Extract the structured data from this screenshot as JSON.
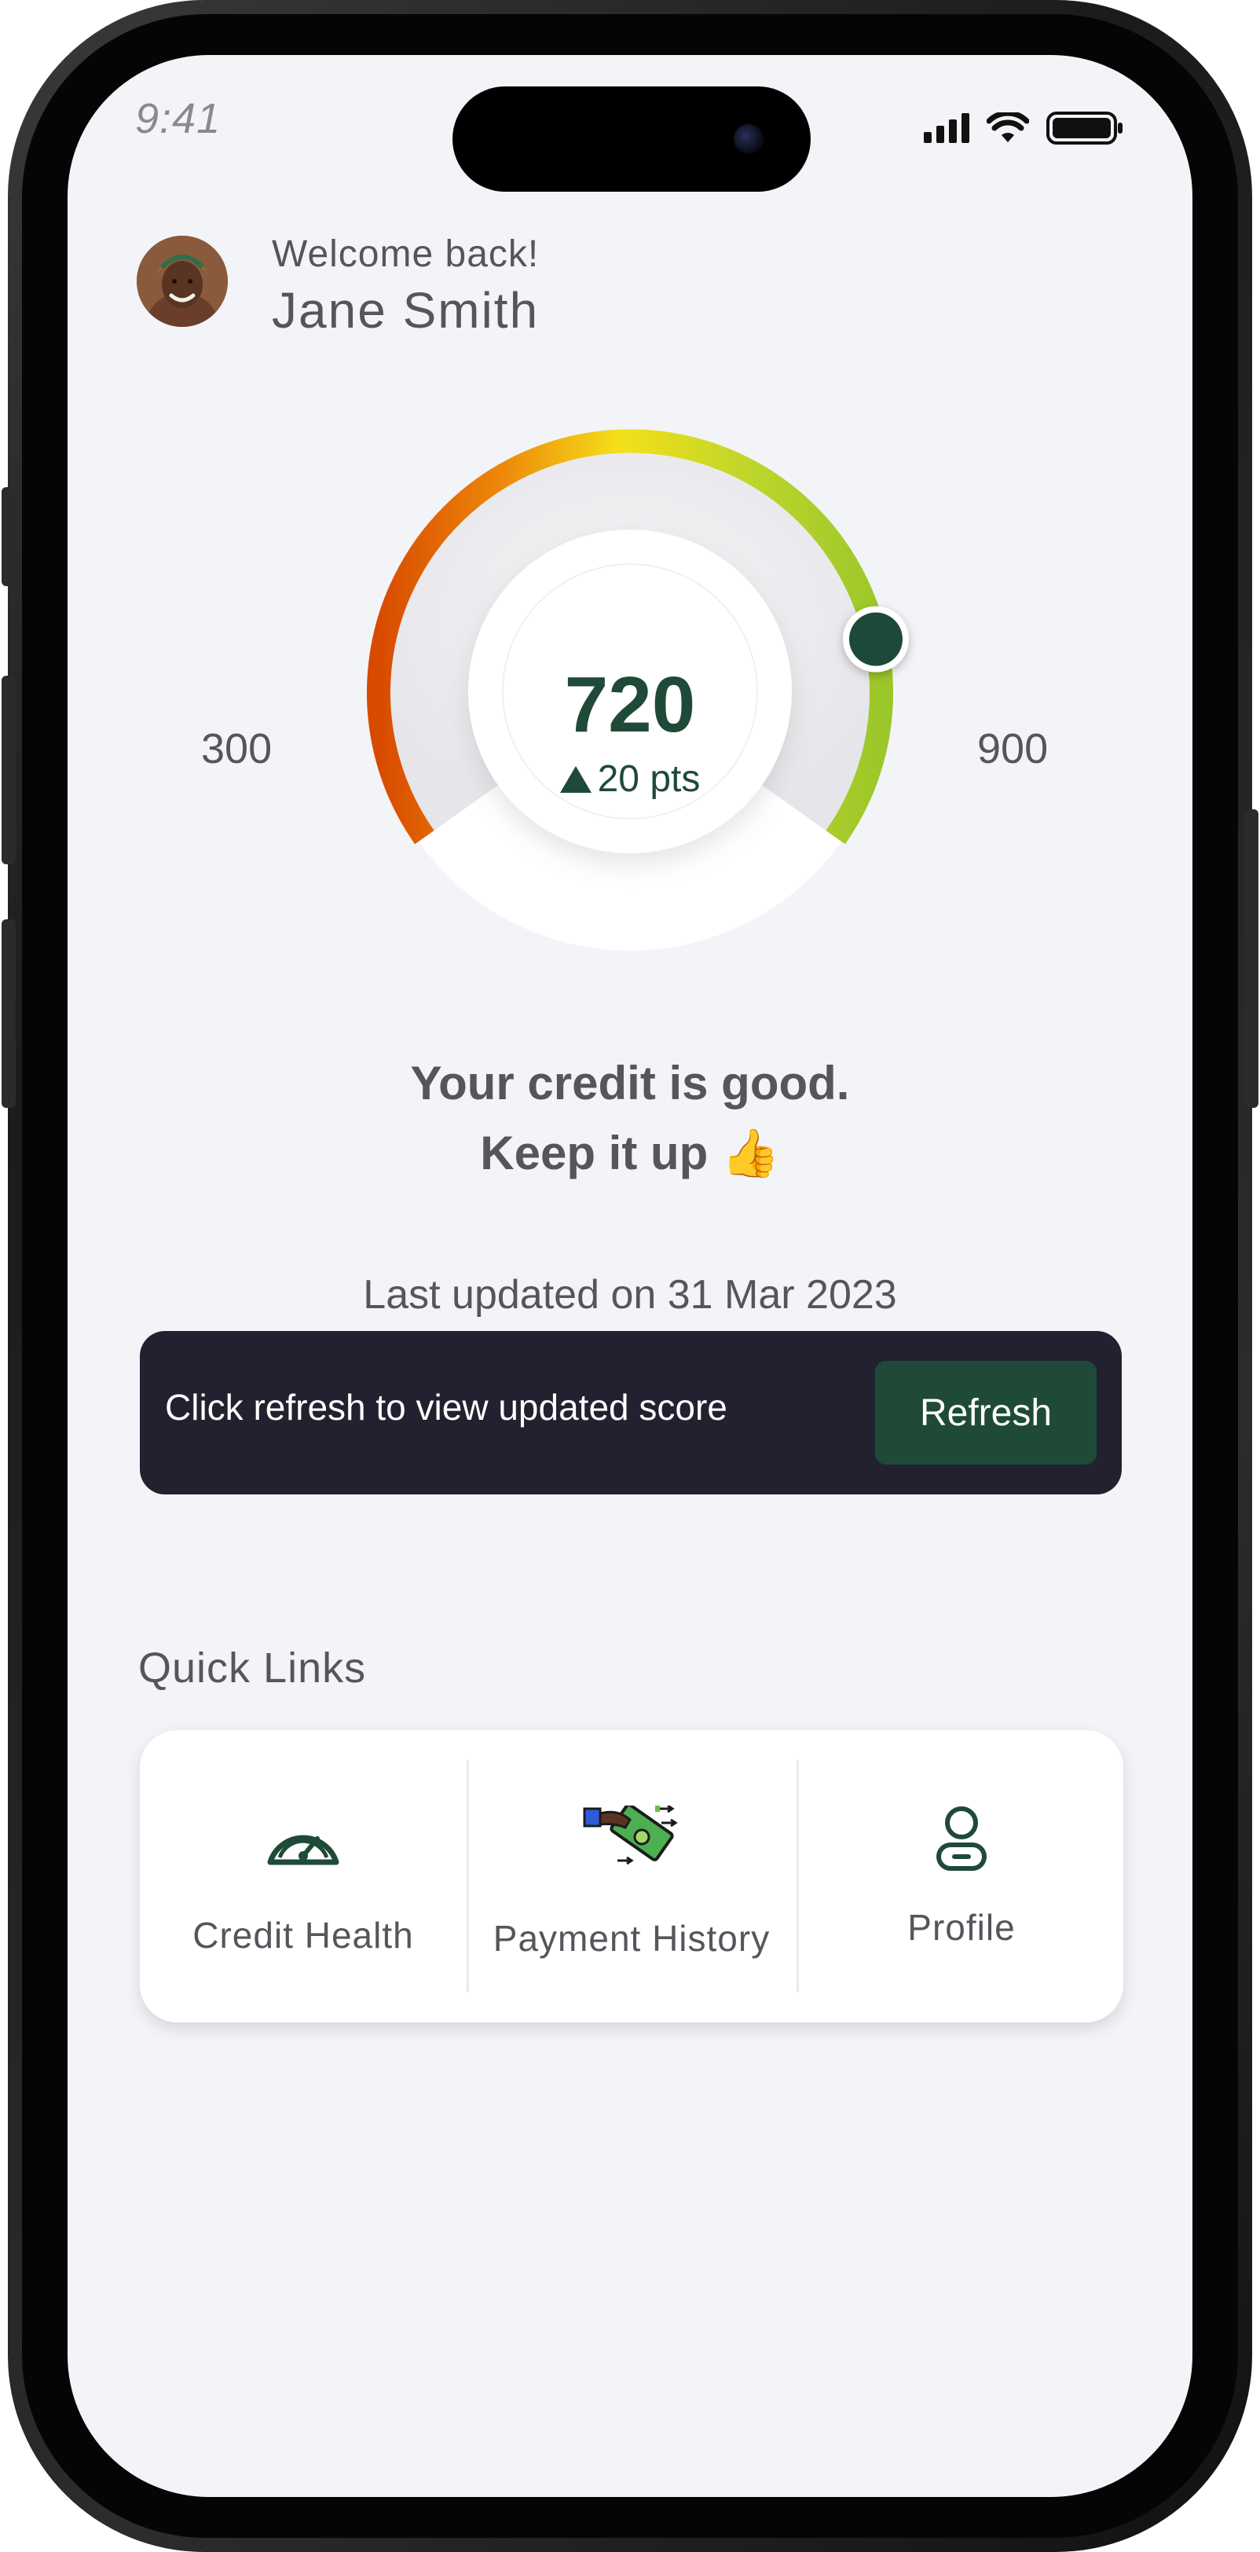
{
  "status_bar": {
    "time": "9:41"
  },
  "header": {
    "greeting": "Welcome back!",
    "user_name": "Jane Smith"
  },
  "credit_score": {
    "score": "720",
    "change": "20 pts",
    "min_label": "300",
    "max_label": "900",
    "score_value": 720,
    "range": [
      300,
      900
    ],
    "marker_color": "#1f4a38"
  },
  "status": {
    "line1": "Your credit is good.",
    "line2": "Keep it up 👍",
    "last_updated": "Last updated on 31 Mar 2023"
  },
  "refresh_banner": {
    "message": "Click refresh to view updated score",
    "button_label": "Refresh"
  },
  "quick_links": {
    "title": "Quick Links",
    "items": [
      {
        "label": "Credit Health",
        "icon": "speedometer-icon"
      },
      {
        "label": "Payment History",
        "icon": "cash-payment-icon"
      },
      {
        "label": "Profile",
        "icon": "user-profile-icon"
      }
    ]
  },
  "colors": {
    "brand_green": "#1f4a38",
    "banner_bg": "#22212f",
    "gauge_gradient": [
      "#d84a00",
      "#f2a20c",
      "#f4e01a",
      "#b9d32a",
      "#9cc72a"
    ]
  }
}
